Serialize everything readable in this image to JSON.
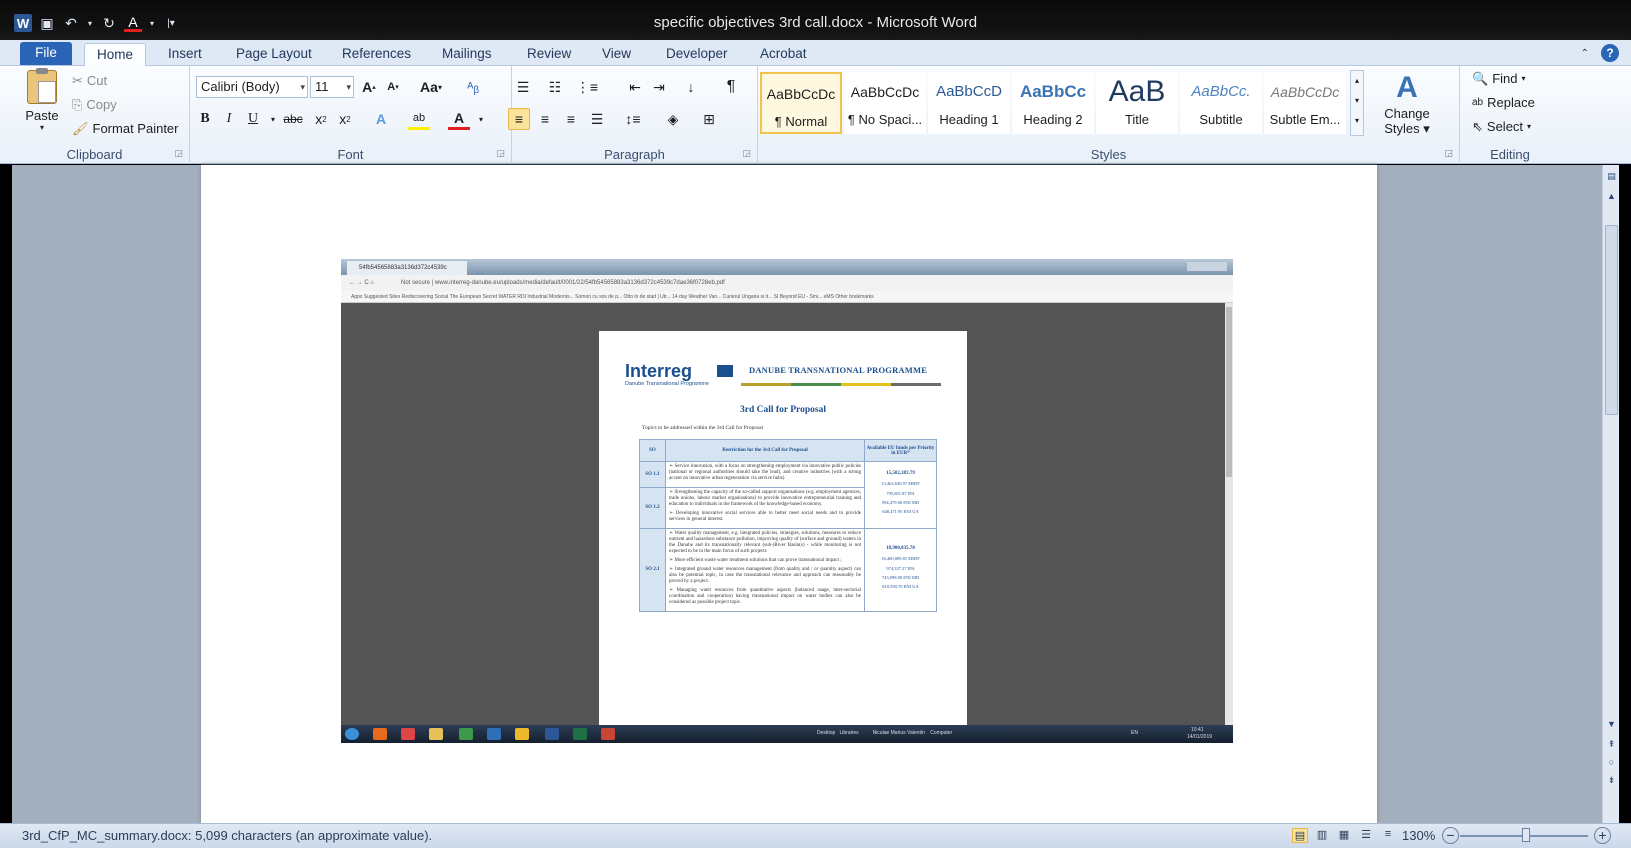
{
  "window": {
    "title": "specific objectives 3rd call.docx  -  Microsoft Word"
  },
  "tabs": {
    "file": "File",
    "items": [
      "Home",
      "Insert",
      "Page Layout",
      "References",
      "Mailings",
      "Review",
      "View",
      "Developer",
      "Acrobat"
    ],
    "active": "Home"
  },
  "clipboard": {
    "paste": "Paste",
    "cut": "Cut",
    "copy": "Copy",
    "format_painter": "Format Painter",
    "label": "Clipboard"
  },
  "font": {
    "name": "Calibri (Body)",
    "size": "11",
    "change_case": "Aa",
    "label": "Font"
  },
  "paragraph": {
    "label": "Paragraph"
  },
  "styles": {
    "items": [
      {
        "sample": "AaBbCcDc",
        "name": "¶ Normal"
      },
      {
        "sample": "AaBbCcDc",
        "name": "¶ No Spaci..."
      },
      {
        "sample": "AaBbCcD",
        "name": "Heading 1"
      },
      {
        "sample": "AaBbCc",
        "name": "Heading 2"
      },
      {
        "sample": "AaB",
        "name": "Title"
      },
      {
        "sample": "AaBbCc.",
        "name": "Subtitle"
      },
      {
        "sample": "AaBbCcDc",
        "name": "Subtle Em..."
      }
    ],
    "change_styles_line1": "Change",
    "change_styles_line2": "Styles",
    "label": "Styles"
  },
  "editing": {
    "find": "Find",
    "replace": "Replace",
    "select": "Select",
    "label": "Editing"
  },
  "embedded": {
    "tab_title": "54fb54565883a3136d372c4539c",
    "address": "Not secure  |  www.interreg-danube.eu/uploads/media/default/0001/22/54fb54565883a3136d372c4539c7dae36f0728eb.pdf",
    "bookmarks": "Apps   Suggested Sites   Rediscovering Social   The European Secret   WATER RDI   Industrial Modernis...   Somon cu sos de p...   Otto in de stad | Utr...   14 day Weather Van...   Curierul Ungaria si it...   SI Beyond EU - Smi...   eMS                                             Other bookmarks",
    "taskbar_text": "Desktop   Libraries          Niculae Marius Valentin    Computer",
    "clock_time": "10:41",
    "clock_date": "14/01/2019",
    "lang": "EN"
  },
  "pdf": {
    "logo": "Interreg",
    "logo_sub": "Danube Transnational Programme",
    "programme": "DANUBE TRANSNATIONAL PROGRAMME",
    "title": "3rd Call for Proposal",
    "intro": "Topics to be addressed within the 3rd Call for Proposal",
    "headers": [
      "SO",
      "Restriction for the 3rd Call for Proposal",
      "Available EU funds per Priority in EUR*"
    ],
    "rows": [
      {
        "so": "SO 1.1",
        "bullets": [
          "Service innovation, with a focus on strengthening employment via innovative public policies (national or regional authorities should take the lead), and creative industries (with a strong accent on innovative urban regeneration via service hubs)"
        ]
      },
      {
        "so": "SO 1.2",
        "bullets": [
          "Strengthening the capacity of the so-called support organisations (e.g. employment agencies, trade unions, labour market organisations) to provide innovative entrepreneurial training and education to individuals in the framework of the knowledge-based economy.",
          "Developing innovative social services able to better meet social needs and to provide services in general interest."
        ]
      },
      {
        "so": "SO 2.1",
        "bullets": [
          "Water quality management, e.g. integrated policies, strategies, solutions, measures to reduce nutrient and hazardous substance pollution, improving quality of (surface and ground) waters in the Danube and its transnationally relevant (sub-)River Basin(s) - while monitoring is not expected to be in the main focus of such projects",
          "More efficient waste water treatment solutions that can prove transnational impact ;",
          "Integrated ground water resources management (from quality and / or quantity aspect) can also be potential topic, in case the transnational relevance and approach can reasonably be proved by a project.",
          "Managing water resources from quantitative aspects (balanced usage, inter-sectorial coordination and cooperation) having transnational impact on water bodies can also be considered as possible project topic."
        ]
      }
    ],
    "funds1": {
      "total": "15,502,383.79",
      "lines": [
        "13,463,630.97 ERDF",
        "795,801.87 IPA",
        "594,479.00 ENI MD",
        "648,471.95 ENI UA"
      ]
    },
    "funds2": {
      "total": "18,900,835.78",
      "lines": [
        "16,460,009.81 ERDF",
        "974,337.27 IPA",
        "743,098.00 ENI MD",
        "810,590.70 ENI UA"
      ]
    }
  },
  "status": {
    "text": "3rd_CfP_MC_summary.docx: 5,099 characters (an approximate value).",
    "zoom": "130%"
  },
  "colors": {
    "accent": "#2a64b6",
    "ribbon_bg": "#e9f0f9",
    "workspace": "#a4afbd"
  }
}
